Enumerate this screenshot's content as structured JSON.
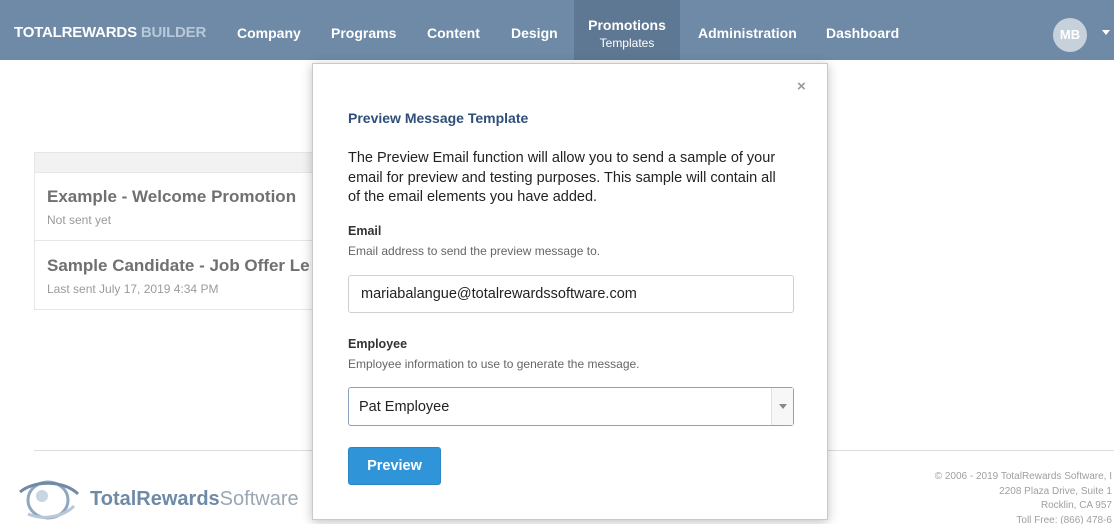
{
  "navbar": {
    "brand_main": "TOTALREWARDS",
    "brand_sub": "BUILDER",
    "items": [
      {
        "label": "Company"
      },
      {
        "label": "Programs"
      },
      {
        "label": "Content"
      },
      {
        "label": "Design"
      },
      {
        "label": "Promotions",
        "sub": "Templates"
      },
      {
        "label": "Administration"
      },
      {
        "label": "Dashboard"
      }
    ],
    "avatar_initials": "MB"
  },
  "list": {
    "items": [
      {
        "title": "Example - Welcome Promotion",
        "meta": "Not sent yet"
      },
      {
        "title": "Sample Candidate - Job Offer Le",
        "meta": "Last sent July 17, 2019 4:34 PM"
      }
    ]
  },
  "footer": {
    "logo_main": "TotalRewards",
    "logo_sub": "Software",
    "lines": [
      "© 2006 - 2019 TotalRewards Software, I",
      "2208 Plaza Drive, Suite 1",
      "Rocklin, CA 957",
      "Toll Free: (866) 478-6"
    ]
  },
  "modal": {
    "close_symbol": "×",
    "title": "Preview Message Template",
    "description": "The Preview Email function will allow you to send a sample of your email for preview and testing purposes. This sample will contain all of the email elements you have added.",
    "email_label": "Email",
    "email_help": "Email address to send the preview message to.",
    "email_value": "mariabalangue@totalrewardssoftware.com",
    "employee_label": "Employee",
    "employee_help": "Employee information to use to generate the message.",
    "employee_value": "Pat Employee",
    "preview_button": "Preview"
  },
  "colors": {
    "navbar": "#6f8aa6",
    "nav_active": "#5e7792",
    "modal_title": "#2f4f7a",
    "primary_button": "#2f95d8"
  }
}
